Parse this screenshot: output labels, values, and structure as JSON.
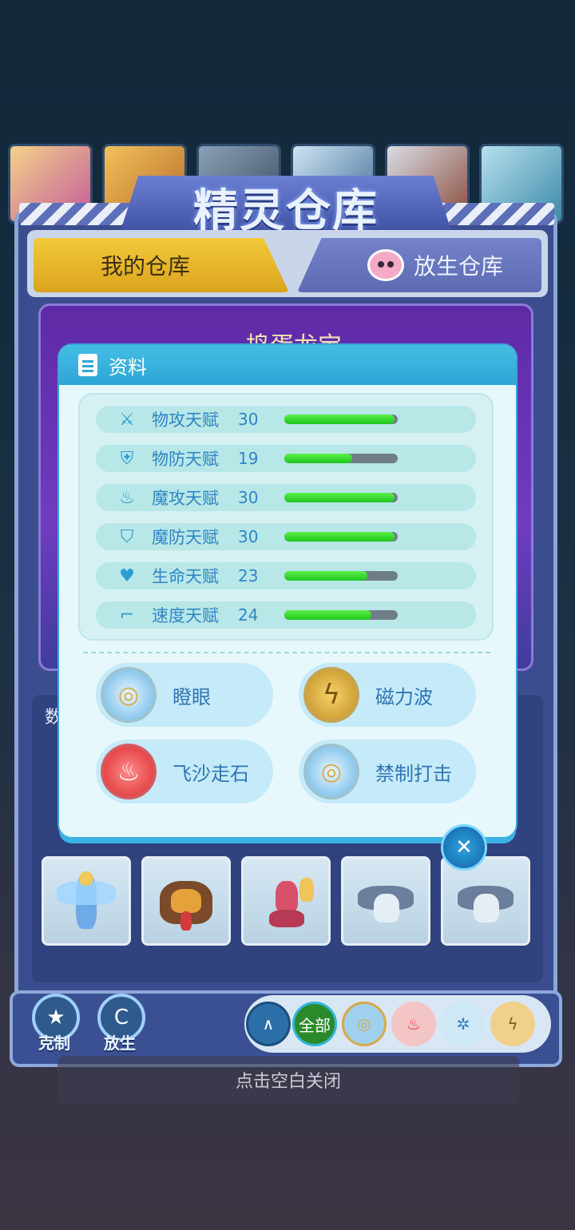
{
  "header": {
    "title": "精灵仓库"
  },
  "tabs": {
    "mine": "我的仓库",
    "release": "放生仓库"
  },
  "behind": {
    "pet_name": "捣蛋龙宝",
    "count_label": "数"
  },
  "dialog": {
    "title": "资料",
    "stats": [
      {
        "icon": "sword-icon",
        "label": "物攻天赋",
        "value": "30",
        "fraction": 0.97
      },
      {
        "icon": "shield-icon",
        "label": "物防天赋",
        "value": "19",
        "fraction": 0.6
      },
      {
        "icon": "flame-icon",
        "label": "魔攻天赋",
        "value": "30",
        "fraction": 0.97
      },
      {
        "icon": "magic-shield-icon",
        "label": "魔防天赋",
        "value": "30",
        "fraction": 0.97
      },
      {
        "icon": "heart-plus-icon",
        "label": "生命天赋",
        "value": "23",
        "fraction": 0.73
      },
      {
        "icon": "boot-icon",
        "label": "速度天赋",
        "value": "24",
        "fraction": 0.77
      }
    ],
    "skills": [
      {
        "name": "瞪眼",
        "icon": "normal-skill-icon",
        "color": "#8fc9ee"
      },
      {
        "name": "磁力波",
        "icon": "electric-skill-icon",
        "color": "#d2a43a"
      },
      {
        "name": "飞沙走石",
        "icon": "fire-skill-icon",
        "color": "#e64a4a"
      },
      {
        "name": "禁制打击",
        "icon": "normal-skill-icon",
        "color": "#8fc9ee"
      }
    ]
  },
  "bottom": {
    "counter_label": "克制",
    "release_label": "放生",
    "filter_all": "全部"
  },
  "hint": "点击空白关闭",
  "colors": {
    "bar_fill": "#1fc51c",
    "accent": "#2ea6d6",
    "tab_active": "#f2c93a"
  }
}
